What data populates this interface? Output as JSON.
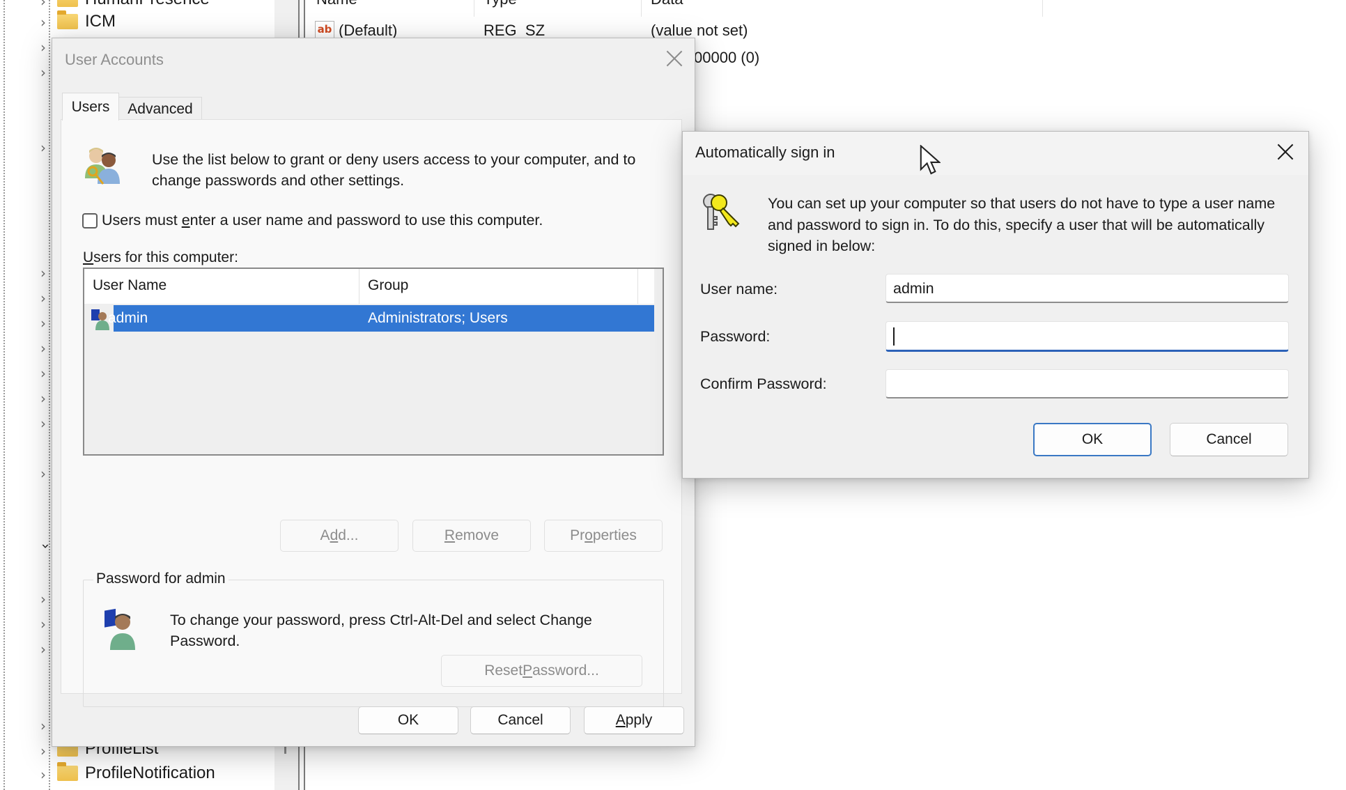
{
  "background_registry": {
    "tree_items": [
      {
        "label": "HumanPresence"
      },
      {
        "label": "ICM"
      },
      {
        "label": "ProfileList"
      },
      {
        "label": "ProfileNotification"
      }
    ],
    "columns": [
      "Name",
      "Type",
      "Data"
    ],
    "rows": [
      {
        "icon": "reg-sz-icon",
        "icon_text": "ab",
        "name": "(Default)",
        "type": "REG_SZ",
        "data": "(value not set)"
      },
      {
        "data_partial": "00000 (0)"
      }
    ]
  },
  "user_accounts": {
    "title": "User Accounts",
    "tabs": [
      {
        "label": "Users",
        "active": true
      },
      {
        "label": "Advanced",
        "active": false
      }
    ],
    "description": "Use the list below to grant or deny users access to your computer, and to change passwords and other settings.",
    "must_enter_checkbox": {
      "label_before": "Users must ",
      "label_mnemonic": "e",
      "label_after": "nter a user name and password to use this computer.",
      "checked": false
    },
    "users_list_label_mnemonic": "U",
    "users_list_label_rest": "sers for this computer:",
    "columns": [
      "User Name",
      "Group"
    ],
    "users": [
      {
        "name": "admin",
        "group": "Administrators; Users",
        "selected": true
      }
    ],
    "list_buttons": {
      "add": {
        "pre": "A",
        "mn": "d",
        "post": "d...",
        "enabled": false
      },
      "remove": {
        "pre": "",
        "mn": "R",
        "post": "emove",
        "enabled": false
      },
      "properties": {
        "pre": "Pr",
        "mn": "o",
        "post": "perties",
        "enabled": false
      }
    },
    "password_group": {
      "label": "Password for admin",
      "text": "To change your password, press Ctrl-Alt-Del and select Change Password.",
      "reset_button": {
        "pre": "Reset ",
        "mn": "P",
        "post": "assword...",
        "enabled": false
      }
    },
    "footer_buttons": {
      "ok": "OK",
      "cancel": "Cancel",
      "apply_mn": "A",
      "apply_rest": "pply"
    }
  },
  "auto_sign_in": {
    "title": "Automatically sign in",
    "description": "You can set up your computer so that users do not have to type a user name and password to sign in. To do this, specify a user that will be automatically signed in below:",
    "fields": {
      "username": {
        "label": "User name:",
        "value": "admin"
      },
      "password": {
        "label": "Password:",
        "value": "",
        "focused": true
      },
      "confirm": {
        "label": "Confirm Password:",
        "value": ""
      }
    },
    "ok": "OK",
    "cancel": "Cancel"
  },
  "colors": {
    "selection": "#3277d3",
    "focus_underline": "#2c62b8",
    "dialog_bg": "#f0f0f0",
    "panel_bg": "#f9f9f9"
  }
}
